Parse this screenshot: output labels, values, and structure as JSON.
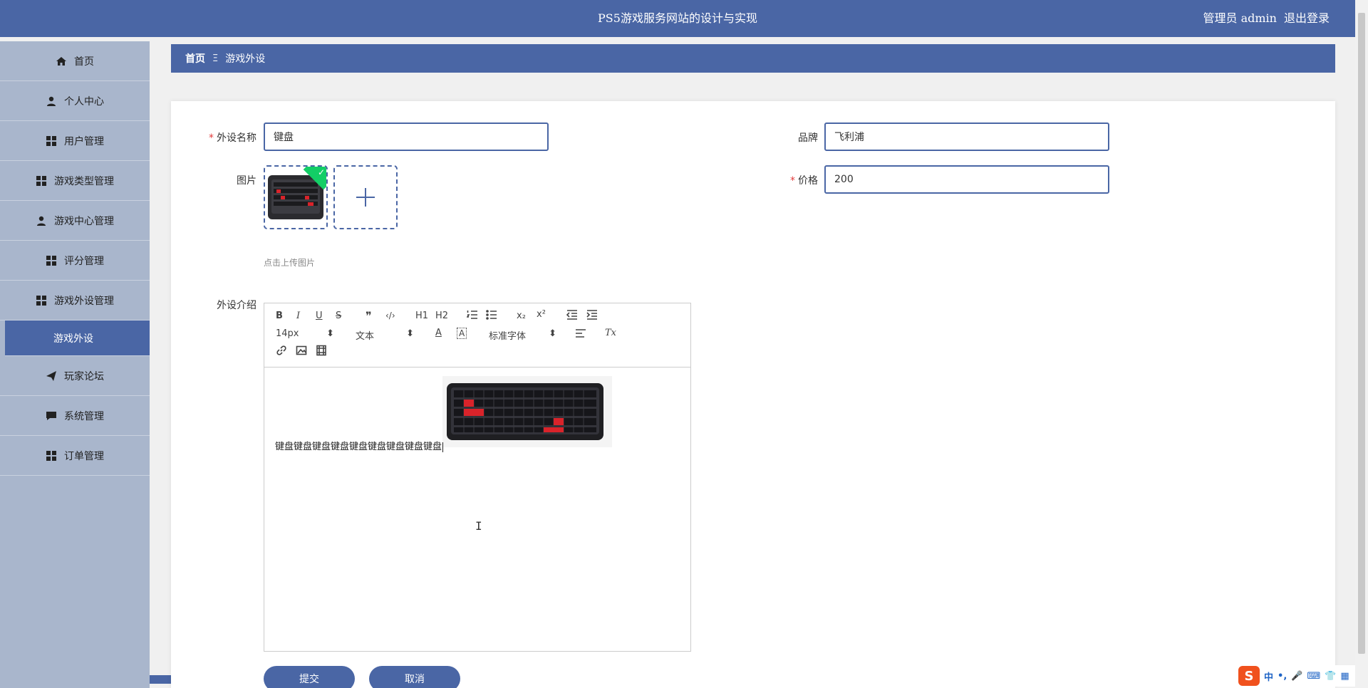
{
  "header": {
    "title": "PS5游戏服务网站的设计与实现",
    "role": "管理员 admin",
    "logout": "退出登录"
  },
  "sidebar": {
    "items": [
      {
        "label": "首页",
        "icon": "home-icon"
      },
      {
        "label": "个人中心",
        "icon": "user-icon"
      },
      {
        "label": "用户管理",
        "icon": "grid-icon"
      },
      {
        "label": "游戏类型管理",
        "icon": "grid-icon"
      },
      {
        "label": "游戏中心管理",
        "icon": "user-icon"
      },
      {
        "label": "评分管理",
        "icon": "grid-icon"
      },
      {
        "label": "游戏外设管理",
        "icon": "grid-icon"
      }
    ],
    "active_sub": "游戏外设",
    "items_after": [
      {
        "label": "玩家论坛",
        "icon": "send-icon"
      },
      {
        "label": "系统管理",
        "icon": "chat-icon"
      },
      {
        "label": "订单管理",
        "icon": "grid-icon"
      }
    ]
  },
  "breadcrumb": {
    "home": "首页",
    "separator": "Ξ",
    "current": "游戏外设"
  },
  "form": {
    "name_label": "外设名称",
    "name_value": "键盘",
    "brand_label": "品牌",
    "brand_value": "飞利浦",
    "image_label": "图片",
    "upload_hint": "点击上传图片",
    "price_label": "价格",
    "price_value": "200",
    "intro_label": "外设介绍",
    "intro_text": "键盘键盘键盘键盘键盘键盘键盘键盘键盘",
    "required_mark": "*"
  },
  "editor": {
    "font_size": "14px",
    "header_select": "文本",
    "font_family": "标准字体",
    "h1": "H1",
    "h2": "H2",
    "sub": "x₂",
    "sup": "x²",
    "clear": "Tx",
    "bold": "B",
    "italic": "I",
    "underline": "U",
    "strike": "S",
    "quote": "❞",
    "code": "‹/›"
  },
  "buttons": {
    "submit": "提交",
    "cancel": "取消"
  },
  "ime": {
    "logo": "S",
    "mode": "中",
    "punct": "•,",
    "mic": "🎤",
    "kbd": "⌨",
    "shirt": "👕",
    "menu": "▦"
  }
}
